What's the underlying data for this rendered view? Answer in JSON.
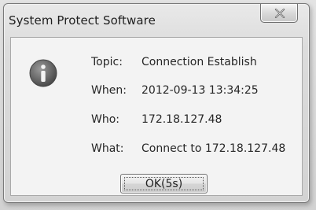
{
  "window": {
    "title": "System Protect Software",
    "close_icon": "close-icon"
  },
  "message": {
    "icon": "info-icon",
    "rows": [
      {
        "label": "Topic:",
        "value": "Connection Establish"
      },
      {
        "label": "When:",
        "value": "2012-09-13 13:34:25"
      },
      {
        "label": "Who:",
        "value": "172.18.127.48"
      },
      {
        "label": "What:",
        "value": "Connect to 172.18.127.48"
      }
    ]
  },
  "buttons": {
    "ok_label": "OK(5s)"
  },
  "colors": {
    "info_icon": "#6b6b6b",
    "text": "#262626"
  }
}
